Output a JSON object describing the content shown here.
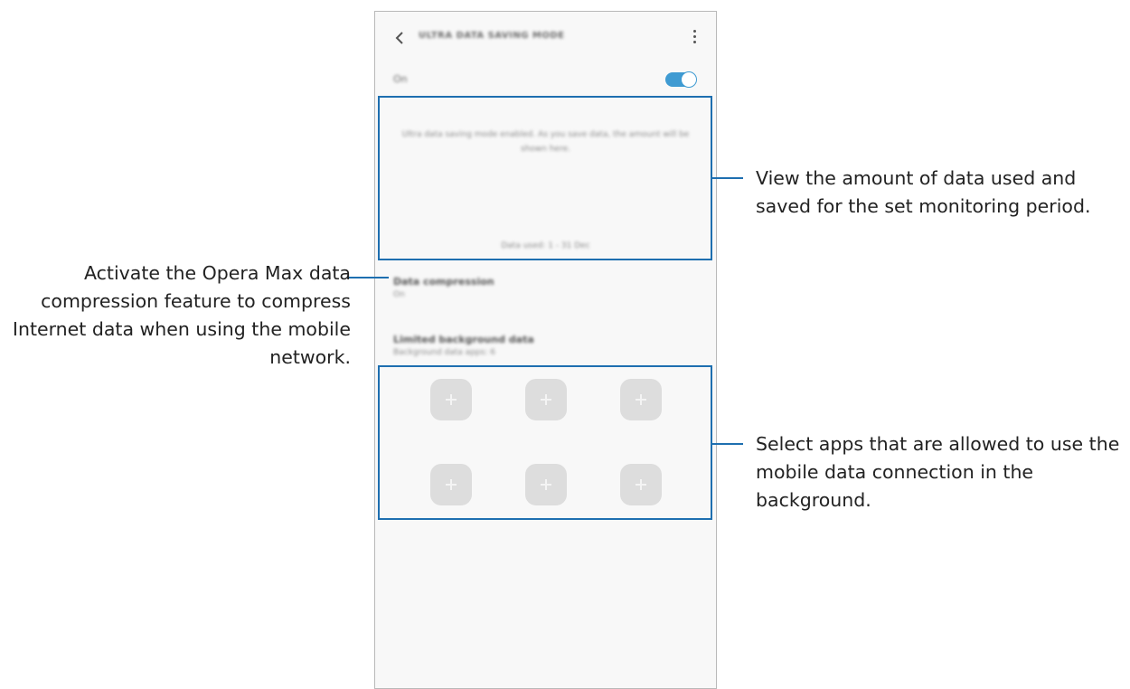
{
  "screen": {
    "title": "ULTRA DATA SAVING MODE",
    "back_icon": "back-arrow-icon",
    "more_icon": "more-vert-icon",
    "switch": {
      "label": "On",
      "state": true,
      "accent": "#3f9bd2"
    }
  },
  "usage": {
    "message": "Ultra data saving mode enabled. As you save data, the amount will be shown here.",
    "period": "Data used: 1 - 31 Dec"
  },
  "items": [
    {
      "title": "Data compression",
      "subtitle": "On"
    },
    {
      "title": "Limited background data",
      "subtitle": "Background data apps: 6"
    }
  ],
  "app_slots": {
    "count": 6,
    "icon": "add-icon"
  },
  "callouts": {
    "usage": "View the amount of data used and saved for the set monitoring period.",
    "compression": "Activate the Opera Max data compression feature to compress Internet data when using the mobile network.",
    "apps": "Select apps that are allowed to use the mobile data connection in the background."
  },
  "colors": {
    "callout": "#1e6fb0",
    "toggle": "#3f9bd2"
  }
}
